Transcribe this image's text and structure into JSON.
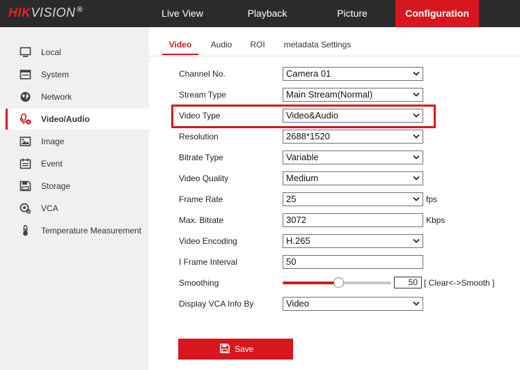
{
  "header": {
    "logo_brand": "HIK",
    "logo_rest": "VISION",
    "logo_mark": "®",
    "nav": {
      "live_view": "Live View",
      "playback": "Playback",
      "picture": "Picture",
      "configuration": "Configuration"
    }
  },
  "sidebar": {
    "items": [
      {
        "label": "Local",
        "icon": "monitor-icon"
      },
      {
        "label": "System",
        "icon": "window-icon"
      },
      {
        "label": "Network",
        "icon": "globe-icon"
      },
      {
        "label": "Video/Audio",
        "icon": "mic-camera-icon"
      },
      {
        "label": "Image",
        "icon": "image-icon"
      },
      {
        "label": "Event",
        "icon": "calendar-icon"
      },
      {
        "label": "Storage",
        "icon": "floppy-icon"
      },
      {
        "label": "VCA",
        "icon": "vca-icon"
      },
      {
        "label": "Temperature Measurement",
        "icon": "thermometer-icon"
      }
    ],
    "active_index": 3
  },
  "tabs": {
    "video": "Video",
    "audio": "Audio",
    "roi": "ROI",
    "metadata": "metadata Settings"
  },
  "form": {
    "channel_no": {
      "label": "Channel No.",
      "value": "Camera 01"
    },
    "stream_type": {
      "label": "Stream Type",
      "value": "Main Stream(Normal)"
    },
    "video_type": {
      "label": "Video Type",
      "value": "Video&Audio"
    },
    "resolution": {
      "label": "Resolution",
      "value": "2688*1520"
    },
    "bitrate_type": {
      "label": "Bitrate Type",
      "value": "Variable"
    },
    "video_quality": {
      "label": "Video Quality",
      "value": "Medium"
    },
    "frame_rate": {
      "label": "Frame Rate",
      "value": "25",
      "unit": "fps"
    },
    "max_bitrate": {
      "label": "Max. Bitrate",
      "value": "3072",
      "unit": "Kbps"
    },
    "video_encoding": {
      "label": "Video Encoding",
      "value": "H.265"
    },
    "i_frame_interval": {
      "label": "I Frame Interval",
      "value": "50"
    },
    "smoothing": {
      "label": "Smoothing",
      "value": "50",
      "level_percent": 50,
      "hint": "[ Clear<->Smooth ]"
    },
    "display_vca": {
      "label": "Display VCA Info By",
      "value": "Video"
    }
  },
  "save_label": "Save",
  "colors": {
    "accent": "#d8161d",
    "topbar": "#2b2b2b",
    "sidebar": "#f0f0f0",
    "highlight": "#e0121b"
  }
}
